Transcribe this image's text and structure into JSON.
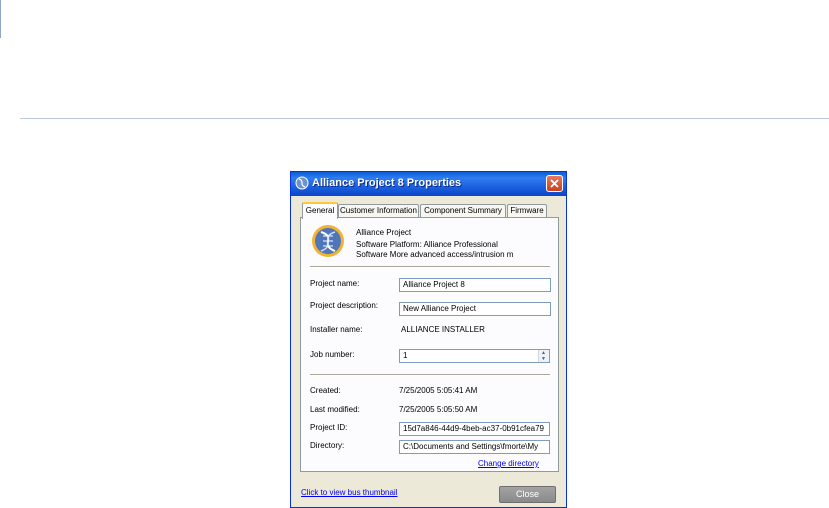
{
  "dialog": {
    "title": "Alliance Project 8 Properties",
    "tabs": [
      "General",
      "Customer Information",
      "Component Summary",
      "Firmware"
    ],
    "header": {
      "name": "Alliance Project",
      "platform": "Software Platform: Alliance Professional",
      "description": "Software More advanced access/intrusion m"
    },
    "fields": {
      "project_name_label": "Project name:",
      "project_name_value": "Alliance Project 8",
      "project_description_label": "Project description:",
      "project_description_value": "New Alliance Project",
      "installer_name_label": "Installer name:",
      "installer_name_value": "ALLIANCE INSTALLER",
      "job_number_label": "Job number:",
      "job_number_value": "1",
      "created_label": "Created:",
      "created_value": "7/25/2005 5:05:41 AM",
      "last_modified_label": "Last modified:",
      "last_modified_value": "7/25/2005 5:05:50 AM",
      "project_id_label": "Project ID:",
      "project_id_value": "15d7a846-44d9-4beb-ac37-0b91cfea79",
      "directory_label": "Directory:",
      "directory_value": "C:\\Documents and Settings\\fmorte\\My"
    },
    "change_directory_link": "Change directory",
    "bus_thumbnail_link": "Click to view bus thumbnail",
    "close_button": "Close"
  }
}
